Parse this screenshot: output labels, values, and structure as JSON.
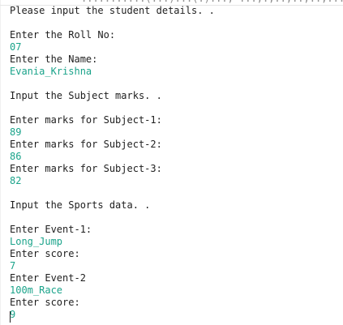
{
  "topbar": {
    "text": "...........(...)...(.)..., ...,.,..,..,..,....,.."
  },
  "console": {
    "lines": [
      {
        "text": "Please input the student details. .",
        "type": "output"
      },
      {
        "text": "",
        "type": "blank"
      },
      {
        "text": "Enter the Roll No:",
        "type": "output"
      },
      {
        "text": "07",
        "type": "input"
      },
      {
        "text": "Enter the Name:",
        "type": "output"
      },
      {
        "text": "Evania_Krishna",
        "type": "input"
      },
      {
        "text": "",
        "type": "blank"
      },
      {
        "text": "Input the Subject marks. .",
        "type": "output"
      },
      {
        "text": "",
        "type": "blank"
      },
      {
        "text": "Enter marks for Subject-1:",
        "type": "output"
      },
      {
        "text": "89",
        "type": "input"
      },
      {
        "text": "Enter marks for Subject-2:",
        "type": "output"
      },
      {
        "text": "86",
        "type": "input"
      },
      {
        "text": "Enter marks for Subject-3:",
        "type": "output"
      },
      {
        "text": "82",
        "type": "input"
      },
      {
        "text": "",
        "type": "blank"
      },
      {
        "text": "Input the Sports data. .",
        "type": "output"
      },
      {
        "text": "",
        "type": "blank"
      },
      {
        "text": "Enter Event-1:",
        "type": "output"
      },
      {
        "text": "Long_Jump",
        "type": "input"
      },
      {
        "text": "Enter score:",
        "type": "output"
      },
      {
        "text": "7",
        "type": "input"
      },
      {
        "text": "Enter Event-2",
        "type": "output"
      },
      {
        "text": "100m_Race",
        "type": "input"
      },
      {
        "text": "Enter score:",
        "type": "output"
      },
      {
        "text": "9",
        "type": "input"
      }
    ]
  },
  "colors": {
    "input_text": "#1aa38a",
    "output_text": "#1e1e1e",
    "background": "#ffffff"
  }
}
